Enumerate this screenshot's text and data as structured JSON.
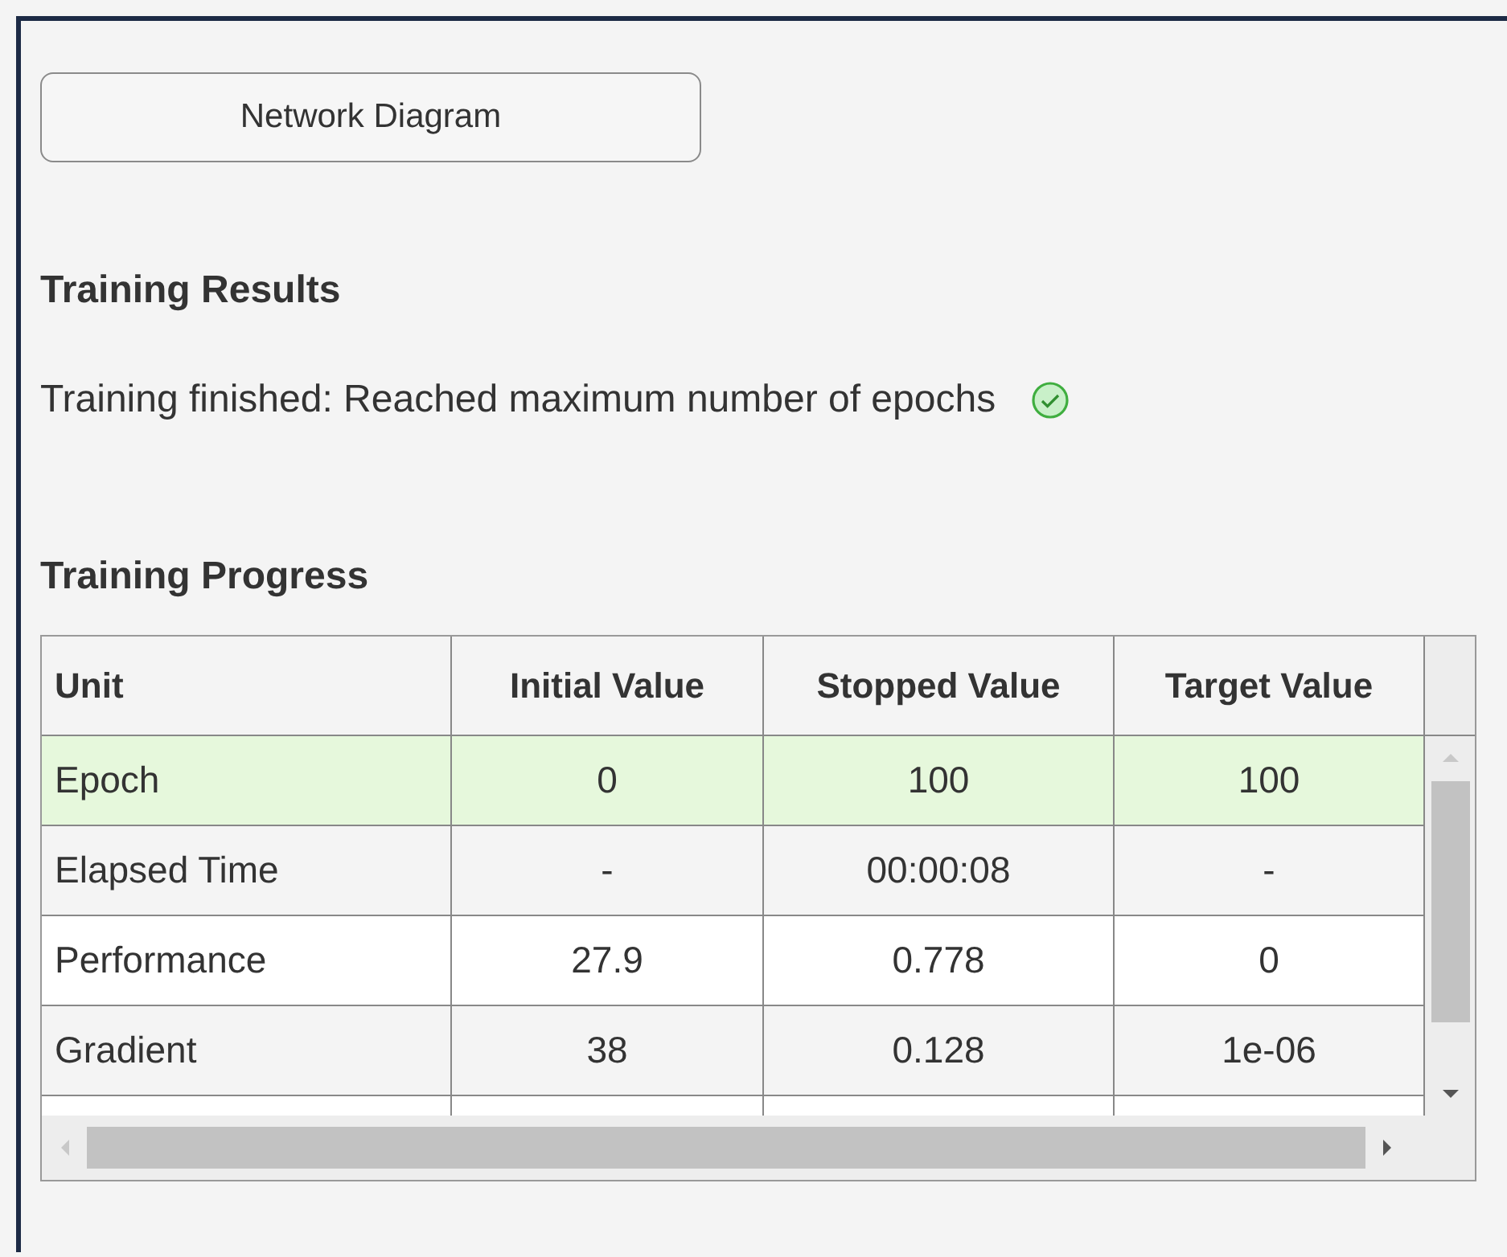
{
  "button": {
    "label": "Network Diagram"
  },
  "results": {
    "heading": "Training Results",
    "message": "Training finished: Reached maximum number of epochs",
    "success": true
  },
  "progress": {
    "heading": "Training Progress",
    "table": {
      "columns": [
        "Unit",
        "Initial Value",
        "Stopped Value",
        "Target Value"
      ],
      "rows": [
        {
          "cells": [
            "Epoch",
            "0",
            "100",
            "100"
          ],
          "selected": true
        },
        {
          "cells": [
            "Elapsed Time",
            "-",
            "00:00:08",
            "-"
          ],
          "selected": false
        },
        {
          "cells": [
            "Performance",
            "27.9",
            "0.778",
            "0"
          ],
          "selected": false
        },
        {
          "cells": [
            "Gradient",
            "38",
            "0.128",
            "1e-06"
          ],
          "selected": false
        }
      ]
    }
  }
}
